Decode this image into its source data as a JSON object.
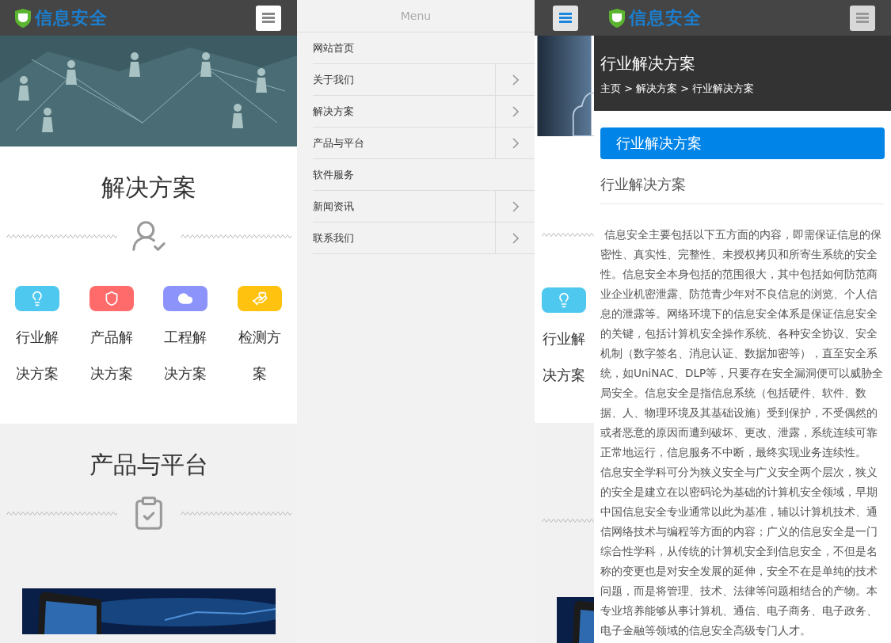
{
  "home": {
    "logo": "信息安全",
    "sections": [
      {
        "title": "解决方案",
        "items": [
          {
            "label": "行业解决方案",
            "color": "#4fc8ef"
          },
          {
            "label": "产品解决方案",
            "color": "#ff6b6b"
          },
          {
            "label": "工程解决方案",
            "color": "#8c93fb"
          },
          {
            "label": "检测方案",
            "color": "#ffc20e"
          }
        ]
      },
      {
        "title": "产品与平台"
      }
    ]
  },
  "menu": {
    "title": "Menu",
    "items": [
      {
        "label": "网站首页",
        "has_submenu": false
      },
      {
        "label": "关于我们",
        "has_submenu": true
      },
      {
        "label": "解决方案",
        "has_submenu": true
      },
      {
        "label": "产品与平台",
        "has_submenu": true
      },
      {
        "label": "软件服务",
        "has_submenu": false
      },
      {
        "label": "新闻资讯",
        "has_submenu": true
      },
      {
        "label": "联系我们",
        "has_submenu": true
      }
    ]
  },
  "behind": {
    "item": {
      "label": "行业解决方案",
      "color": "#4fc8ef"
    }
  },
  "detail": {
    "logo": "信息安全",
    "title": "行业解决方案",
    "breadcrumb": "主页 > 解决方案 > 行业解决方案",
    "category": "行业解决方案",
    "heading": "行业解决方案",
    "paragraphs": [
      "信息安全主要包括以下五方面的内容，即需保证信息的保密性、真实性、完整性、未授权拷贝和所寄生系统的安全性。信息安全本身包括的范围很大，其中包括如何防范商业企业机密泄露、防范青少年对不良信息的浏览、个人信息的泄露等。网络环境下的信息安全体系是保证信息安全的关键，包括计算机安全操作系统、各种安全协议、安全机制（数字签名、消息认证、数据加密等），直至安全系统，如UniNAC、DLP等，只要存在安全漏洞便可以威胁全局安全。信息安全是指信息系统（包括硬件、软件、数据、人、物理环境及其基础设施）受到保护，不受偶然的或者恶意的原因而遭到破坏、更改、泄露，系统连续可靠正常地运行，信息服务不中断，最终实现业务连续性。",
      "信息安全学科可分为狭义安全与广义安全两个层次，狭义的安全是建立在以密码论为基础的计算机安全领域，早期中国信息安全专业通常以此为基准，辅以计算机技术、通信网络技术与编程等方面的内容；广义的信息安全是一门综合性学科，从传统的计算机安全到信息安全，不但是名称的变更也是对安全发展的延伸，安全不在是单纯的技术问题，而是将管理、技术、法律等问题相结合的产物。本专业培养能够从事计算机、通信、电子商务、电子政务、电子金融等领域的信息安全高级专门人才。"
    ]
  }
}
